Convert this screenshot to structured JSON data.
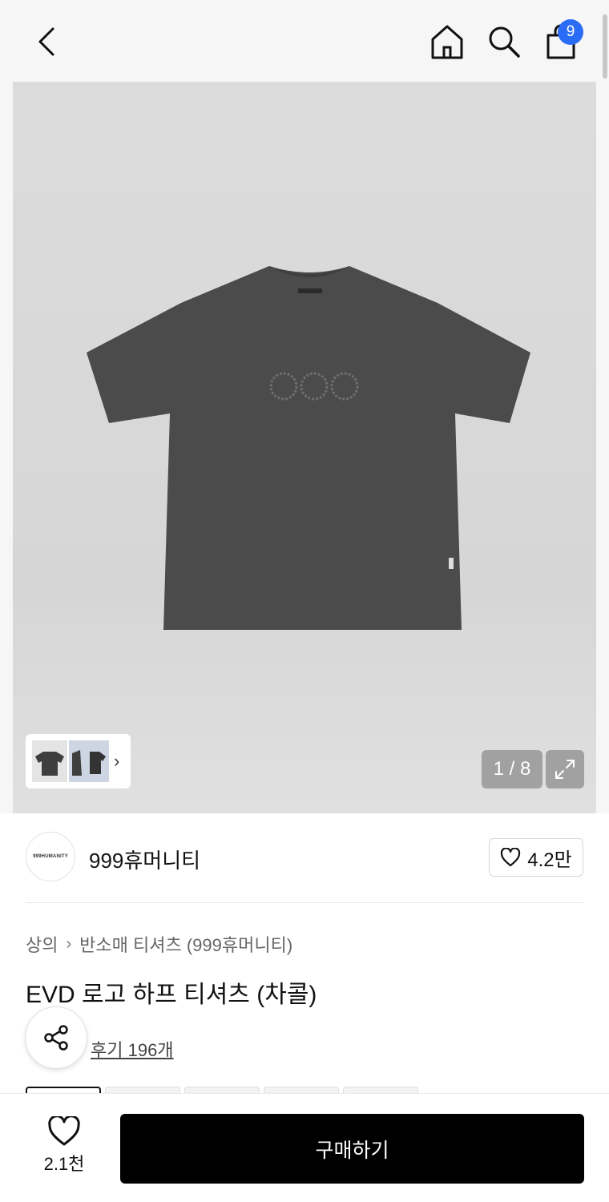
{
  "header": {
    "back_icon": "chevron-left-icon",
    "home_icon": "home-icon",
    "search_icon": "search-icon",
    "cart_icon": "shopping-bag-icon",
    "cart_count": "9",
    "badge_color": "#2b6cf6"
  },
  "gallery": {
    "counter": "1 / 8",
    "expand_icon": "expand-icon",
    "thumbnail_chevron": "›"
  },
  "brand": {
    "logo_text": "999HUMANITY",
    "name": "999휴머니티",
    "likes": "4.2만"
  },
  "breadcrumb": {
    "items": [
      "상의",
      "반소매 티셔츠 (999휴머니티)"
    ],
    "separator": "›"
  },
  "product": {
    "title": "EVD 로고 하프 티셔츠 (차콜)",
    "review_link": "후기 196개"
  },
  "bottom_bar": {
    "wish_count": "2.1천",
    "buy_label": "구매하기"
  }
}
